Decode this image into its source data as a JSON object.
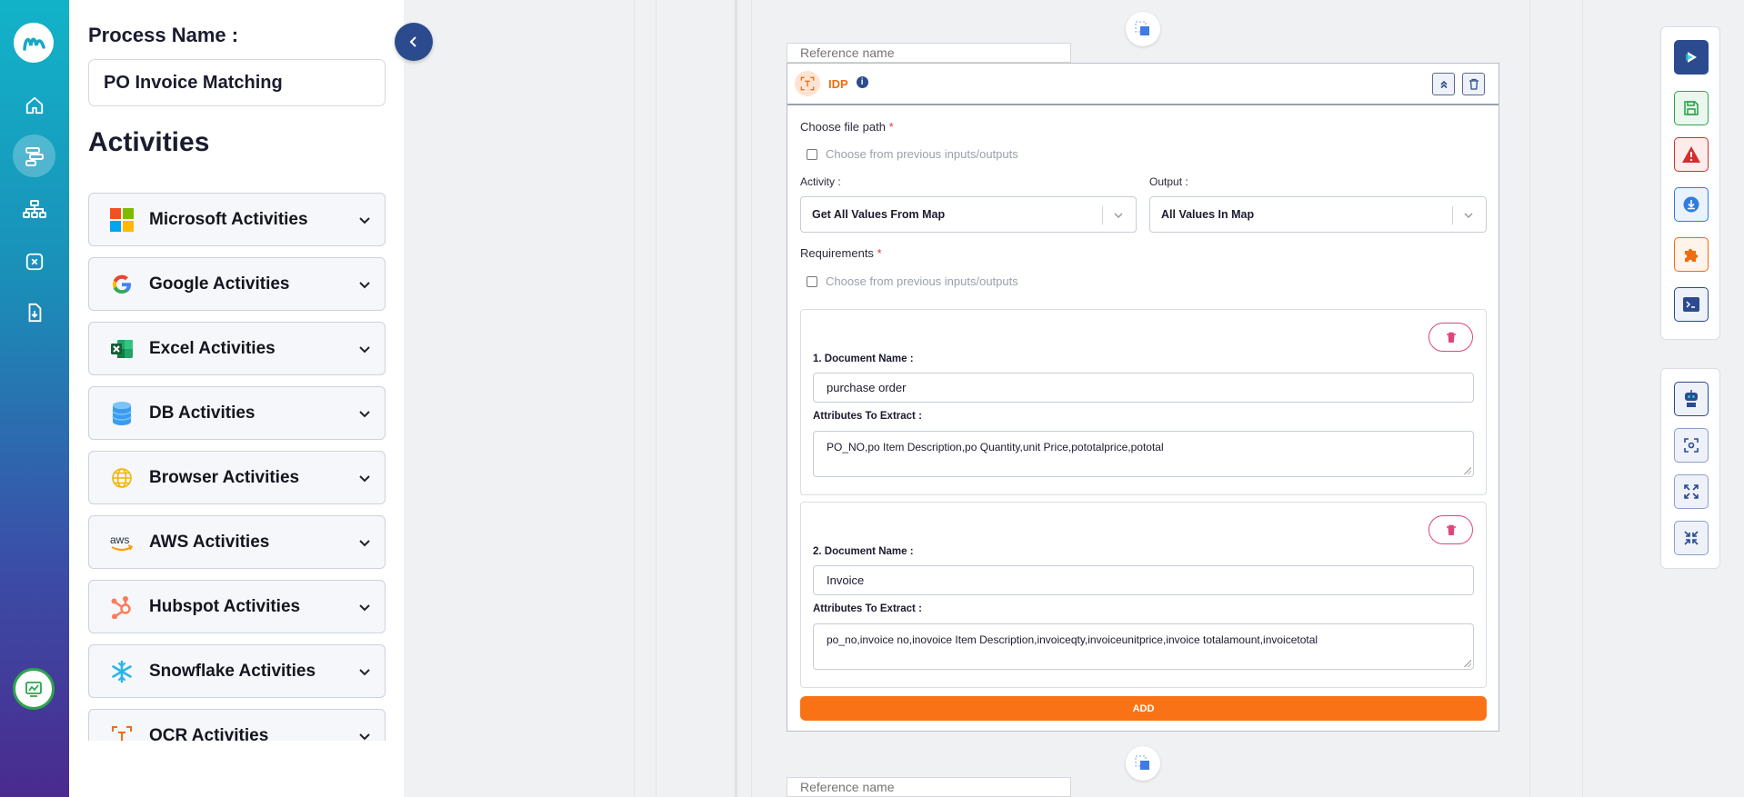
{
  "sidebar": {
    "nav": [
      {
        "name": "home-icon",
        "active": false
      },
      {
        "name": "process-flow-icon",
        "active": true
      },
      {
        "name": "hierarchy-icon",
        "active": false
      },
      {
        "name": "variable-icon",
        "active": false
      },
      {
        "name": "download-file-icon",
        "active": false
      }
    ]
  },
  "process": {
    "label": "Process Name :",
    "value": "PO Invoice Matching"
  },
  "activities": {
    "title": "Activities",
    "groups": [
      {
        "label": "Microsoft Activities",
        "icon": "microsoft-icon"
      },
      {
        "label": "Google Activities",
        "icon": "google-icon"
      },
      {
        "label": "Excel Activities",
        "icon": "excel-icon"
      },
      {
        "label": "DB Activities",
        "icon": "database-icon"
      },
      {
        "label": "Browser Activities",
        "icon": "globe-icon"
      },
      {
        "label": "AWS Activities",
        "icon": "aws-icon"
      },
      {
        "label": "Hubspot Activities",
        "icon": "hubspot-icon"
      },
      {
        "label": "Snowflake Activities",
        "icon": "snowflake-icon"
      },
      {
        "label": "OCR Activities",
        "icon": "ocr-icon"
      }
    ]
  },
  "canvas": {
    "ref_placeholder": "Reference name",
    "card": {
      "title": "IDP",
      "info": "i",
      "file_path_label": "Choose file path",
      "file_path_checkbox": "Choose from previous inputs/outputs",
      "activity_label": "Activity :",
      "activity_value": "Get All Values From Map",
      "output_label": "Output :",
      "output_value": "All Values In Map",
      "requirements_label": "Requirements",
      "requirements_checkbox": "Choose from previous inputs/outputs",
      "required_mark": "*",
      "documents": [
        {
          "name_label": "1. Document Name :",
          "name_value": "purchase order",
          "attr_label": "Attributes To Extract :",
          "attr_value": "PO_NO,po Item Description,po Quantity,unit Price,pototalprice,pototal"
        },
        {
          "name_label": "2. Document Name :",
          "name_value": "Invoice",
          "attr_label": "Attributes To Extract :",
          "attr_value": "po_no,invoice no,inovoice Item Description,invoiceqty,invoiceunitprice,invoice totalamount,invoicetotal"
        }
      ],
      "add_label": "ADD"
    }
  },
  "toolbar": {
    "top": [
      "play-icon",
      "save-icon",
      "warning-icon",
      "download-gear-icon",
      "puzzle-icon",
      "terminal-icon"
    ],
    "bottom": [
      "bot-icon",
      "focus-icon",
      "expand-icon",
      "collapse-icon"
    ]
  },
  "colors": {
    "accent": "#f97316",
    "primary": "#2b4b8e",
    "danger": "#e0457a"
  }
}
